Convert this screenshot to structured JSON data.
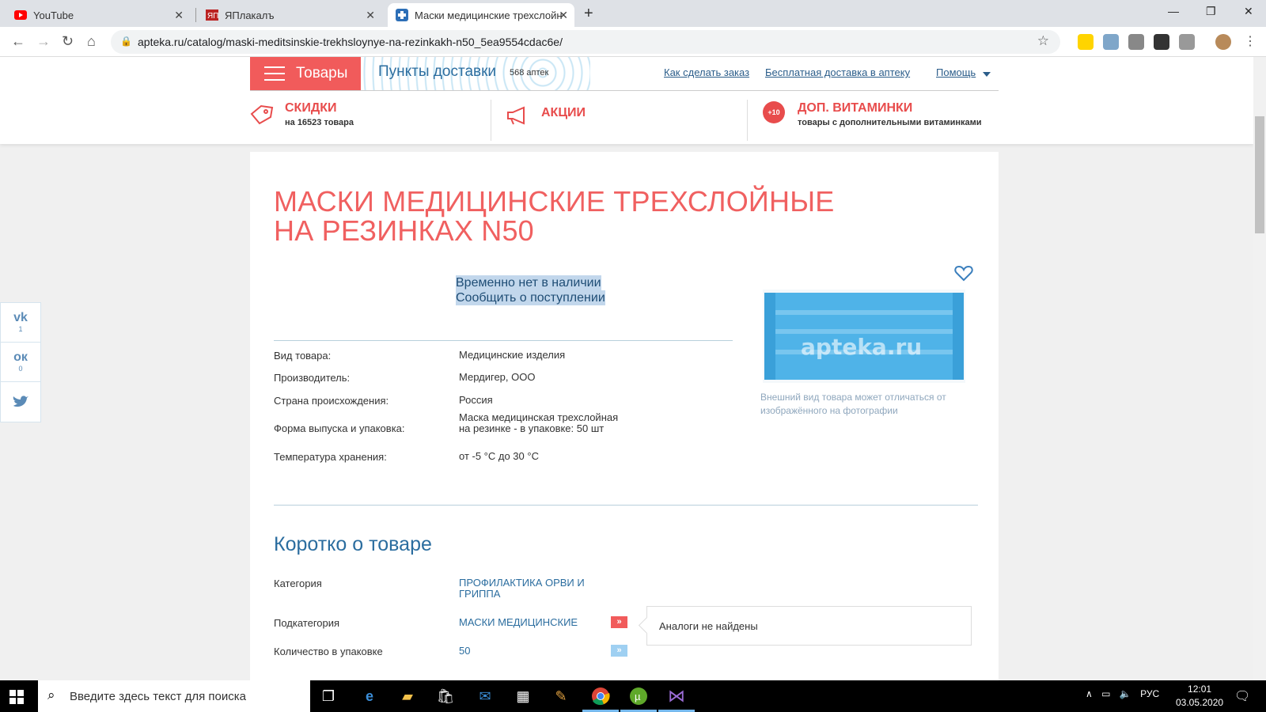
{
  "browser": {
    "tabs": [
      {
        "title": "YouTube",
        "icon": "youtube-icon"
      },
      {
        "title": "ЯПлакалъ",
        "icon": "yaplakal-icon"
      },
      {
        "title": "Маски медицинские трехслойн",
        "icon": "apteka-icon"
      }
    ],
    "url": "apteka.ru/catalog/maski-meditsinskie-trekhsloynye-na-rezinkakh-n50_5ea9554cdac6e/"
  },
  "site": {
    "menu_label": "Товары",
    "delivery_points": "Пункты доставки",
    "pharmacy_count": "568 аптек",
    "links": [
      "Как сделать заказ",
      "Бесплатная доставка в аптеку",
      "Помощь"
    ],
    "promos": [
      {
        "title": "СКИДКИ",
        "sub": "на 16523 товара"
      },
      {
        "title": "АКЦИИ",
        "sub": ""
      },
      {
        "badge": "+10",
        "title": "ДОП. ВИТАМИНКИ",
        "sub": "товары с дополнительными витаминками"
      }
    ]
  },
  "product": {
    "title": "МАСКИ МЕДИЦИНСКИЕ ТРЕХСЛОЙНЫЕ НА РЕЗИНКАХ N50",
    "availability": "Временно нет в наличии",
    "notify": "Сообщить о поступлении",
    "specs": [
      {
        "label": "Вид товара:",
        "value": "Медицинские изделия"
      },
      {
        "label": "Производитель:",
        "value": "Мердигер, ООО"
      },
      {
        "label": "Страна происхождения:",
        "value": "Россия"
      },
      {
        "label": "Форма выпуска и упаковка:",
        "value": "Маска медицинская трехслойная на резинке - в упаковке: 50 шт"
      },
      {
        "label": "Температура хранения:",
        "value": "от -5 °С до 30 °С"
      }
    ],
    "watermark": "apteka.ru",
    "image_note": "Внешний вид товара может отличаться от изображённого на фотографии",
    "brief_title": "Коротко о товаре",
    "brief": [
      {
        "label": "Категория",
        "value": "ПРОФИЛАКТИКА ОРВИ И ГРИППА"
      },
      {
        "label": "Подкатегория",
        "value": "МАСКИ МЕДИЦИНСКИЕ"
      },
      {
        "label": "Количество в упаковке",
        "value": "50"
      }
    ],
    "analogs": "Аналоги не найдены"
  },
  "social": [
    {
      "icon": "vk-icon",
      "count": "1"
    },
    {
      "icon": "ok-icon",
      "count": "0"
    },
    {
      "icon": "twitter-icon",
      "count": ""
    }
  ],
  "taskbar": {
    "search_placeholder": "Введите здесь текст для поиска",
    "lang": "РУС",
    "time": "12:01",
    "date": "03.05.2020"
  },
  "colors": {
    "accent": "#f15b5b",
    "link": "#2b6d9f",
    "highlight": "#c2d7ec"
  }
}
